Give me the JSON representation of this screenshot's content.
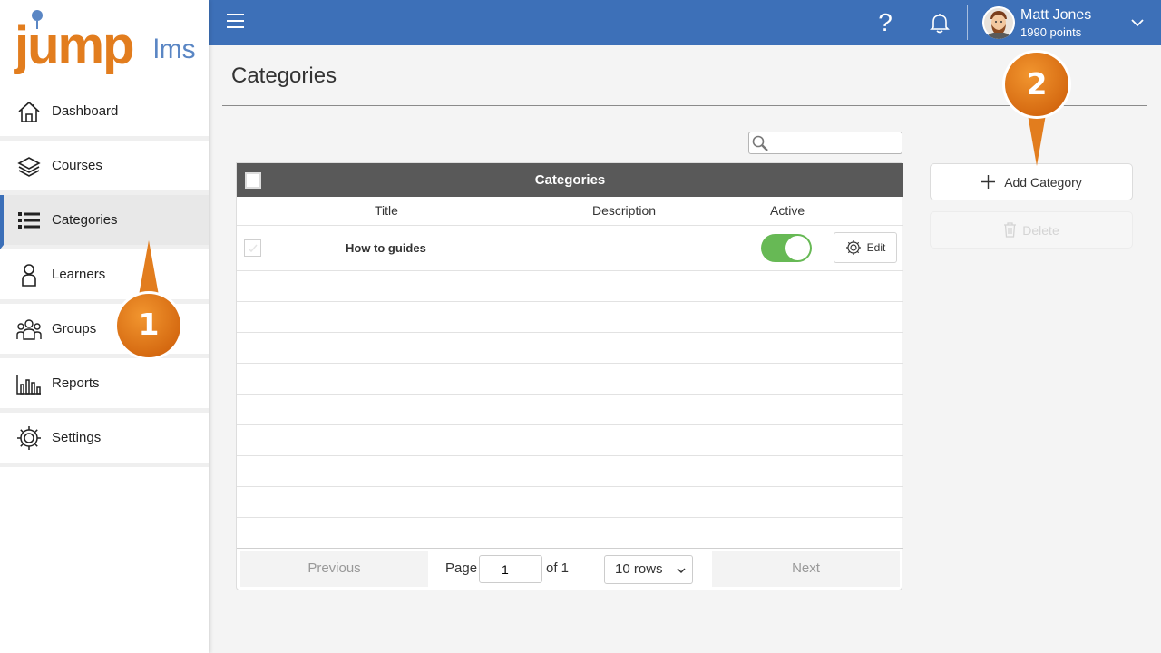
{
  "brand": {
    "logo_main": "jump",
    "logo_sub": "lms",
    "accent": "#3d70b8",
    "orange": "#e27d1e"
  },
  "sidebar": {
    "items": [
      {
        "label": "Dashboard",
        "icon": "home-icon"
      },
      {
        "label": "Courses",
        "icon": "layers-icon"
      },
      {
        "label": "Categories",
        "icon": "list-icon",
        "active": true
      },
      {
        "label": "Learners",
        "icon": "person-icon"
      },
      {
        "label": "Groups",
        "icon": "group-icon"
      },
      {
        "label": "Reports",
        "icon": "bar-chart-icon"
      },
      {
        "label": "Settings",
        "icon": "gear-icon"
      }
    ]
  },
  "topbar": {
    "user_name": "Matt Jones",
    "user_points": "1990 points",
    "help_glyph": "?"
  },
  "page": {
    "title": "Categories"
  },
  "table": {
    "header_title": "Categories",
    "columns": [
      "Title",
      "Description",
      "Active"
    ],
    "rows": [
      {
        "title": "How to guides",
        "description": "",
        "active": true,
        "edit_label": "Edit"
      }
    ],
    "pager": {
      "previous_label": "Previous",
      "next_label": "Next",
      "page_label": "Page",
      "page_value": "1",
      "of_label": "of 1",
      "rows_label": "10 rows"
    }
  },
  "actions": {
    "add_label": "Add Category",
    "delete_label": "Delete"
  },
  "callouts": {
    "first": "1",
    "second": "2"
  }
}
